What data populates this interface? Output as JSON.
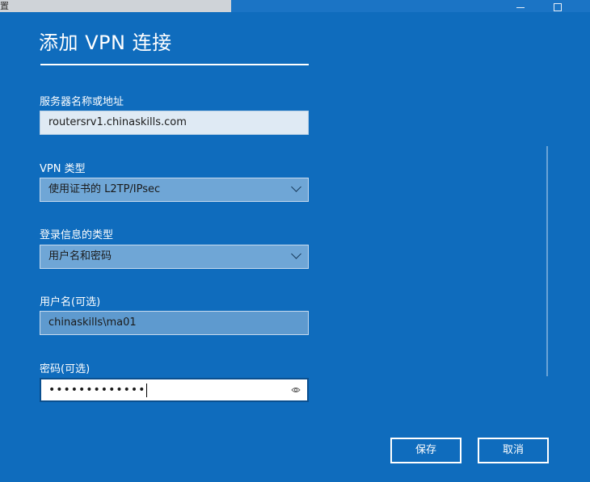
{
  "window": {
    "clipped_title": "置"
  },
  "dialog": {
    "title": "添加 VPN 连接",
    "server_label": "服务器名称或地址",
    "server_value": "routersrv1.chinaskills.com",
    "vpn_type_label": "VPN 类型",
    "vpn_type_value": "使用证书的 L2TP/IPsec",
    "signin_type_label": "登录信息的类型",
    "signin_type_value": "用户名和密码",
    "username_label": "用户名(可选)",
    "username_value": "chinaskills\\ma01",
    "password_label": "密码(可选)",
    "password_value": "•••••••••••••",
    "save_label": "保存",
    "cancel_label": "取消"
  },
  "colors": {
    "background": "#0f6cbd",
    "select_fill": "#6fa6d6",
    "input_fill": "#dfeaf4"
  },
  "icons": {
    "reveal": "eye-icon",
    "dropdown": "chevron-down-icon"
  }
}
